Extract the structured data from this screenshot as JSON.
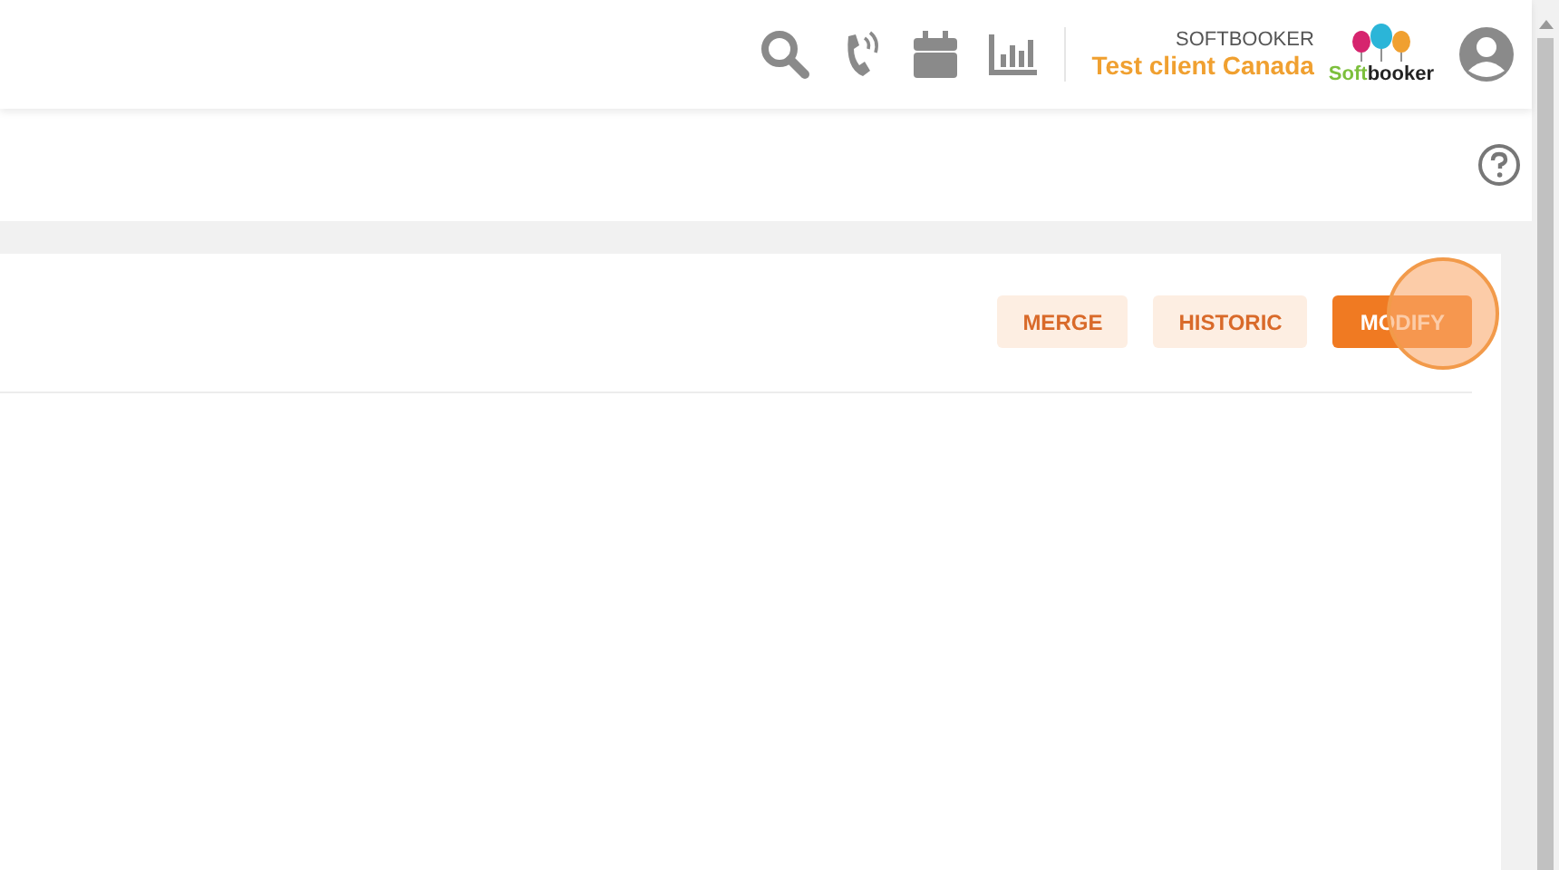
{
  "header": {
    "company": "SOFTBOOKER",
    "client": "Test client Canada",
    "logo": {
      "text_start": "Soft",
      "text_end": "booker"
    }
  },
  "actions": [
    {
      "label": "MERGE",
      "kind": "secondary"
    },
    {
      "label": "HISTORIC",
      "kind": "secondary"
    },
    {
      "label": "MODIFY",
      "kind": "primary"
    }
  ],
  "click_indicator": {
    "on": true
  }
}
